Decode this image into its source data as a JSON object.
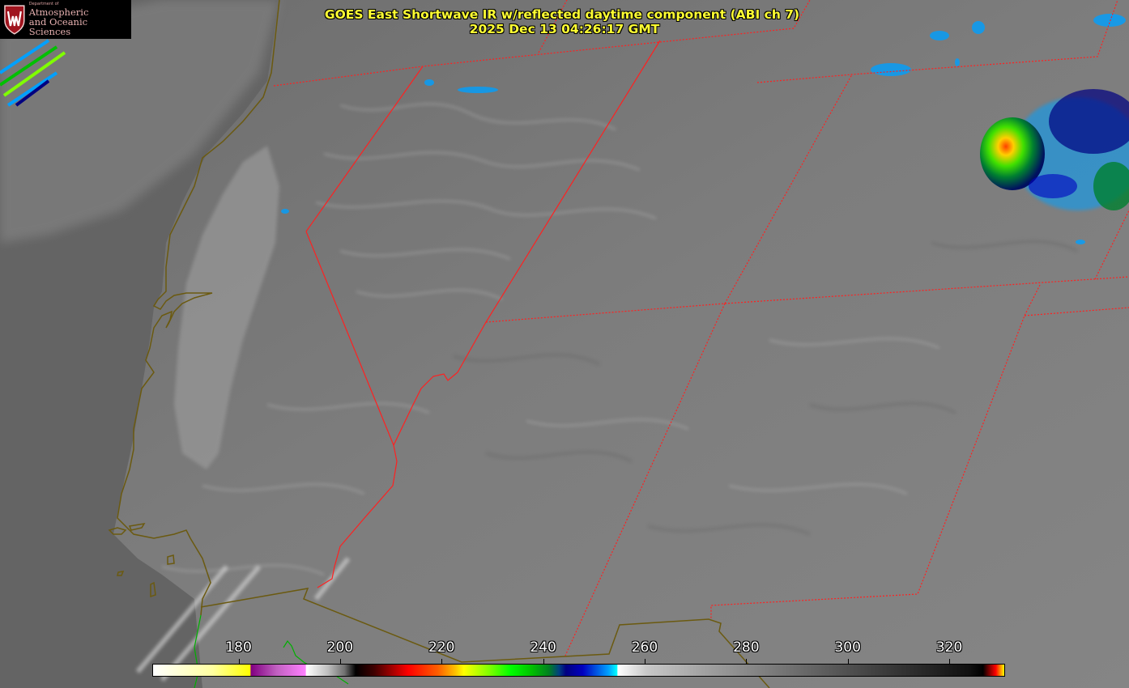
{
  "logo": {
    "dept": "Department of",
    "line1": "Atmospheric",
    "line2": "and Oceanic Sciences",
    "icon": "uw-crest-icon"
  },
  "title": {
    "line1": "GOES East Shortwave IR w/reflected daytime component (ABI ch 7)",
    "line2": "2025 Dec 13 04:26:17 GMT"
  },
  "colorbar": {
    "ticks": [
      {
        "value": 180,
        "label": "180"
      },
      {
        "value": 200,
        "label": "200"
      },
      {
        "value": 220,
        "label": "220"
      },
      {
        "value": 240,
        "label": "240"
      },
      {
        "value": 260,
        "label": "260"
      },
      {
        "value": 280,
        "label": "280"
      },
      {
        "value": 300,
        "label": "300"
      },
      {
        "value": 320,
        "label": "320"
      }
    ],
    "min": 163,
    "max": 331
  },
  "colors": {
    "title": "#ffff33",
    "coastline": "#6b5a10",
    "state_border": "#ff2020",
    "background": "#7a7a7a"
  }
}
